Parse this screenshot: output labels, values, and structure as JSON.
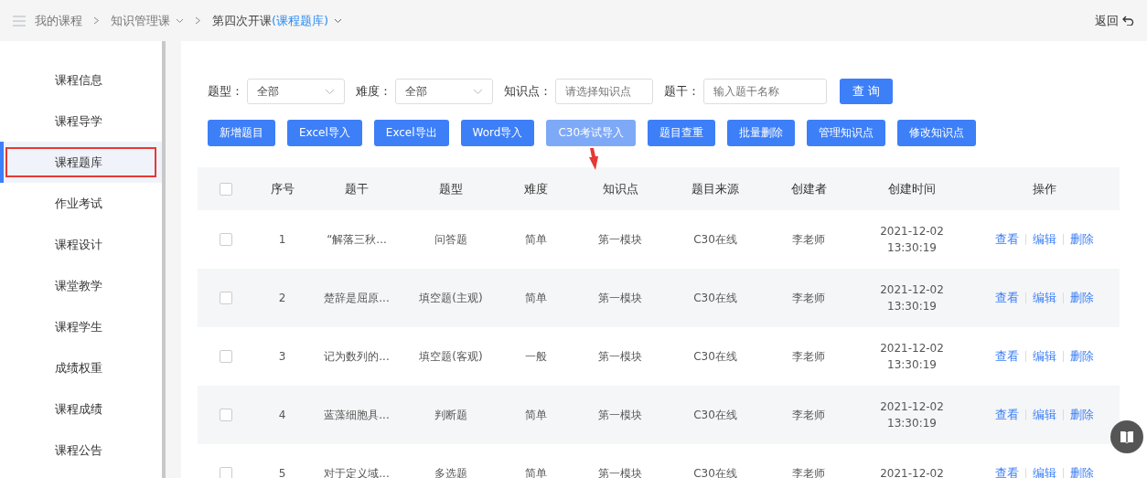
{
  "breadcrumb": {
    "items": [
      "我的课程",
      "知识管理课"
    ],
    "current": "第四次开课",
    "current_section": "(课程题库)"
  },
  "back_link": "返回",
  "sidebar": {
    "items": [
      {
        "label": "课程信息",
        "selected": false,
        "boxed": false
      },
      {
        "label": "课程导学",
        "selected": false,
        "boxed": false
      },
      {
        "label": "课程题库",
        "selected": true,
        "boxed": true
      },
      {
        "label": "作业考试",
        "selected": false,
        "boxed": false
      },
      {
        "label": "课程设计",
        "selected": false,
        "boxed": false
      },
      {
        "label": "课堂教学",
        "selected": false,
        "boxed": false
      },
      {
        "label": "课程学生",
        "selected": false,
        "boxed": false
      },
      {
        "label": "成绩权重",
        "selected": false,
        "boxed": false
      },
      {
        "label": "课程成绩",
        "selected": false,
        "boxed": false
      },
      {
        "label": "课程公告",
        "selected": false,
        "boxed": false
      }
    ]
  },
  "filters": [
    {
      "kind": "select",
      "label": "题型：",
      "value": "全部"
    },
    {
      "kind": "select",
      "label": "难度：",
      "value": "全部"
    },
    {
      "kind": "input",
      "label": "知识点：",
      "placeholder": "请选择知识点"
    },
    {
      "kind": "input",
      "label": "题干：",
      "placeholder": "输入题干名称"
    }
  ],
  "search_button": "查 询",
  "actions": [
    {
      "label": "新增题目",
      "hovered": false,
      "pointed": false
    },
    {
      "label": "Excel导入",
      "hovered": false,
      "pointed": false
    },
    {
      "label": "Excel导出",
      "hovered": false,
      "pointed": false
    },
    {
      "label": "Word导入",
      "hovered": false,
      "pointed": false
    },
    {
      "label": "C30考试导入",
      "hovered": true,
      "pointed": true
    },
    {
      "label": "题目查重",
      "hovered": false,
      "pointed": false
    },
    {
      "label": "批量删除",
      "hovered": false,
      "pointed": false
    },
    {
      "label": "管理知识点",
      "hovered": false,
      "pointed": false
    },
    {
      "label": "修改知识点",
      "hovered": false,
      "pointed": false
    }
  ],
  "table": {
    "all_checked": false,
    "columns": [
      "序号",
      "题干",
      "题型",
      "难度",
      "知识点",
      "题目来源",
      "创建者",
      "创建时间",
      "操作"
    ],
    "rows": [
      {
        "checked": false,
        "cells": [
          "1",
          "“解落三秋...",
          "问答题",
          "简单",
          "第一模块",
          "C30在线",
          "李老师"
        ],
        "time": [
          "2021-12-02",
          "13:30:19"
        ],
        "actions": [
          "查看",
          "编辑",
          "删除"
        ]
      },
      {
        "checked": false,
        "cells": [
          "2",
          "楚辞是屈原...",
          "填空题(主观)",
          "简单",
          "第一模块",
          "C30在线",
          "李老师"
        ],
        "time": [
          "2021-12-02",
          "13:30:19"
        ],
        "actions": [
          "查看",
          "编辑",
          "删除"
        ]
      },
      {
        "checked": false,
        "cells": [
          "3",
          "记为数列的...",
          "填空题(客观)",
          "一般",
          "第一模块",
          "C30在线",
          "李老师"
        ],
        "time": [
          "2021-12-02",
          "13:30:19"
        ],
        "actions": [
          "查看",
          "编辑",
          "删除"
        ]
      },
      {
        "checked": false,
        "cells": [
          "4",
          "蓝藻细胞具...",
          "判断题",
          "简单",
          "第一模块",
          "C30在线",
          "李老师"
        ],
        "time": [
          "2021-12-02",
          "13:30:19"
        ],
        "actions": [
          "查看",
          "编辑",
          "删除"
        ]
      },
      {
        "checked": false,
        "cells": [
          "5",
          "对于定义域...",
          "多选题",
          "简单",
          "第一模块",
          "C30在线",
          "李老师"
        ],
        "time": [
          "2021-12-02"
        ],
        "actions": [
          "查看",
          "编辑",
          "删除"
        ]
      }
    ]
  }
}
